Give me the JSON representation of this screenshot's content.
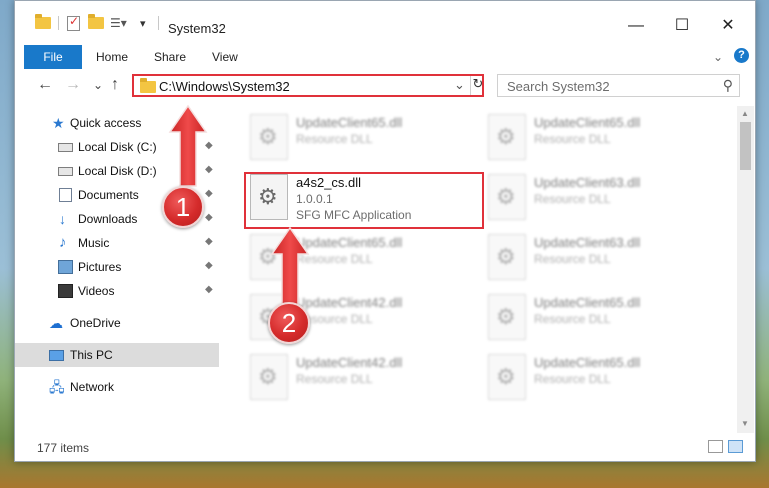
{
  "window": {
    "title": "System32",
    "controls": {
      "minimize": "—",
      "maximize": "☐",
      "close": "✕"
    }
  },
  "ribbon": {
    "tabs": [
      "File",
      "Home",
      "Share",
      "View"
    ],
    "expand_chevron": "⌄",
    "help": "?"
  },
  "navigation": {
    "back": "←",
    "forward": "→",
    "recent": "⌄",
    "up": "↑"
  },
  "address_bar": {
    "path": "C:\\Windows\\System32",
    "dropdown": "⌄",
    "refresh": "↻"
  },
  "search": {
    "placeholder": "Search System32",
    "icon": "search-icon"
  },
  "sidebar": {
    "items": [
      {
        "label": "Quick access",
        "icon": "star-icon"
      },
      {
        "label": "Local Disk (C:)",
        "icon": "drive-icon",
        "pinned": true
      },
      {
        "label": "Local Disk (D:)",
        "icon": "drive-icon",
        "pinned": true
      },
      {
        "label": "Documents",
        "icon": "documents-icon",
        "pinned": true
      },
      {
        "label": "Downloads",
        "icon": "downloads-icon",
        "pinned": true
      },
      {
        "label": "Music",
        "icon": "music-icon",
        "pinned": true
      },
      {
        "label": "Pictures",
        "icon": "pictures-icon",
        "pinned": true
      },
      {
        "label": "Videos",
        "icon": "videos-icon",
        "pinned": true
      },
      {
        "label": "OneDrive",
        "icon": "onedrive-icon"
      },
      {
        "label": "This PC",
        "icon": "this-pc-icon",
        "selected": true
      },
      {
        "label": "Network",
        "icon": "network-icon"
      }
    ],
    "pin_glyph": "📌"
  },
  "files": {
    "highlighted": {
      "name": "a4s2_cs.dll",
      "version": "1.0.0.1",
      "description": "SFG MFC Application"
    },
    "background": [
      {
        "name": "UpdateClient65.dll",
        "type": "Resource DLL"
      },
      {
        "name": "UpdateClient65.dll",
        "type": "Resource DLL"
      },
      {
        "name": "UpdateClient63.dll",
        "type": "Resource DLL"
      },
      {
        "name": "UpdateClient65.dll",
        "type": "Resource DLL"
      },
      {
        "name": "UpdateClient63.dll",
        "type": "Resource DLL"
      },
      {
        "name": "UpdateClient42.dll",
        "type": "Resource DLL"
      },
      {
        "name": "UpdateClient65.dll",
        "type": "Resource DLL"
      },
      {
        "name": "UpdateClient42.dll",
        "type": "Resource DLL"
      },
      {
        "name": "UpdateClient65.dll",
        "type": "Resource DLL"
      }
    ]
  },
  "status": {
    "item_count": "177 items"
  },
  "annotations": {
    "badge_1": "1",
    "badge_2": "2"
  },
  "colors": {
    "accent": "#1979ca",
    "annotation_red": "#e0313a",
    "selected_bg": "#dcdcdc"
  }
}
